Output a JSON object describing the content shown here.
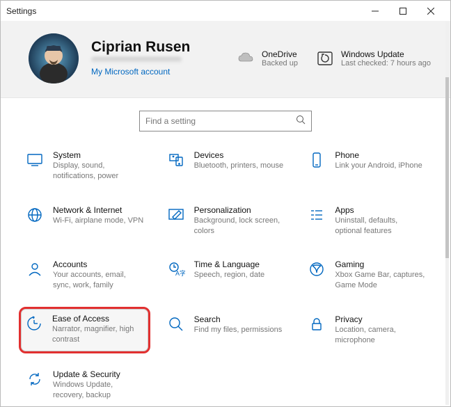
{
  "window": {
    "title": "Settings"
  },
  "header": {
    "user_name": "Ciprian Rusen",
    "account_link": "My Microsoft account",
    "onedrive": {
      "title": "OneDrive",
      "sub": "Backed up"
    },
    "windows_update": {
      "title": "Windows Update",
      "sub": "Last checked: 7 hours ago"
    }
  },
  "search": {
    "placeholder": "Find a setting"
  },
  "tiles": {
    "system": {
      "title": "System",
      "sub": "Display, sound, notifications, power"
    },
    "devices": {
      "title": "Devices",
      "sub": "Bluetooth, printers, mouse"
    },
    "phone": {
      "title": "Phone",
      "sub": "Link your Android, iPhone"
    },
    "network": {
      "title": "Network & Internet",
      "sub": "Wi-Fi, airplane mode, VPN"
    },
    "personal": {
      "title": "Personalization",
      "sub": "Background, lock screen, colors"
    },
    "apps": {
      "title": "Apps",
      "sub": "Uninstall, defaults, optional features"
    },
    "accounts": {
      "title": "Accounts",
      "sub": "Your accounts, email, sync, work, family"
    },
    "time": {
      "title": "Time & Language",
      "sub": "Speech, region, date"
    },
    "gaming": {
      "title": "Gaming",
      "sub": "Xbox Game Bar, captures, Game Mode"
    },
    "ease": {
      "title": "Ease of Access",
      "sub": "Narrator, magnifier, high contrast"
    },
    "search_t": {
      "title": "Search",
      "sub": "Find my files, permissions"
    },
    "privacy": {
      "title": "Privacy",
      "sub": "Location, camera, microphone"
    },
    "update": {
      "title": "Update & Security",
      "sub": "Windows Update, recovery, backup"
    }
  }
}
